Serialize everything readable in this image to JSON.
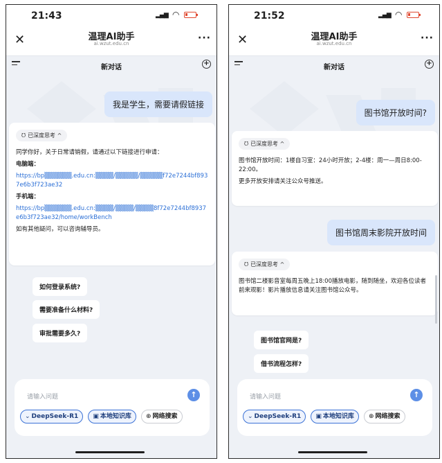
{
  "colors": {
    "user_bubble": "#d9e6fb",
    "link": "#2b6fd6",
    "accent": "#3b72d6",
    "send_button": "#5d8fe6",
    "battery": "#e0482f"
  },
  "icons": {
    "close": "close-icon",
    "more": "more-icon",
    "menu": "menu-icon",
    "new_chat": "new-chat-icon",
    "think": "brain-icon",
    "send": "send-arrow-icon",
    "model": "chevron-down-icon",
    "kb": "knowledge-base-icon",
    "web": "globe-icon"
  },
  "left": {
    "status": {
      "time": "21:43"
    },
    "nav": {
      "title": "温理AI助手",
      "url": "ai.wzut.edu.cn"
    },
    "chat_title": "新对话",
    "user_message": "我是学生，需要请假链接",
    "ai": {
      "think_label": "已深度思考 ^",
      "intro": "同学你好，关于日常请销假，请通过以下链接进行申请：",
      "pc_label": "电脑端：",
      "pc_link": "https://bp▒▒▒▒▒▒.edu.cn:▒▒▒▒/▒▒▒▒▒/▒▒▒▒▒f72e7244bf8937e6b3f723ae32",
      "mobile_label": "手机端：",
      "mobile_link": "https://bp▒▒▒▒▒▒.edu.cn:▒▒▒▒/▒▒▒▒/▒▒▒▒8f72e7244bf8937e6b3f723ae32/home/workBench",
      "outro": "如有其他疑问，可以咨询辅导员。"
    },
    "suggestions": [
      "如何登录系统?",
      "需要准备什么材料?",
      "审批需要多久?"
    ],
    "input": {
      "placeholder": "请输入问题",
      "chips": {
        "model": "DeepSeek-R1",
        "kb": "本地知识库",
        "web": "网络搜索"
      }
    }
  },
  "right": {
    "status": {
      "time": "21:52"
    },
    "nav": {
      "title": "温理AI助手",
      "url": "ai.wzut.edu.cn"
    },
    "chat_title": "新对话",
    "user_message_1": "图书馆开放时间?",
    "ai_1": {
      "think_label": "已深度思考 ^",
      "text": "图书馆开放时间：1楼自习室：24小时开放；2-4楼：周一—周日8:00-22:00。",
      "text2": "更多开放安排请关注公众号推送。"
    },
    "user_message_2": "图书馆周末影院开放时间",
    "ai_2": {
      "think_label": "已深度思考 ^",
      "text": "图书馆二楼影音室每周五晚上18:00播放电影，随到随坐，欢迎各位读者前来观影！影片播放信息请关注图书馆公众号。"
    },
    "suggestions": [
      "图书馆官网是?",
      "借书流程怎样?"
    ],
    "input": {
      "placeholder": "请输入问题",
      "chips": {
        "model": "DeepSeek-R1",
        "kb": "本地知识库",
        "web": "网络搜索"
      }
    }
  }
}
